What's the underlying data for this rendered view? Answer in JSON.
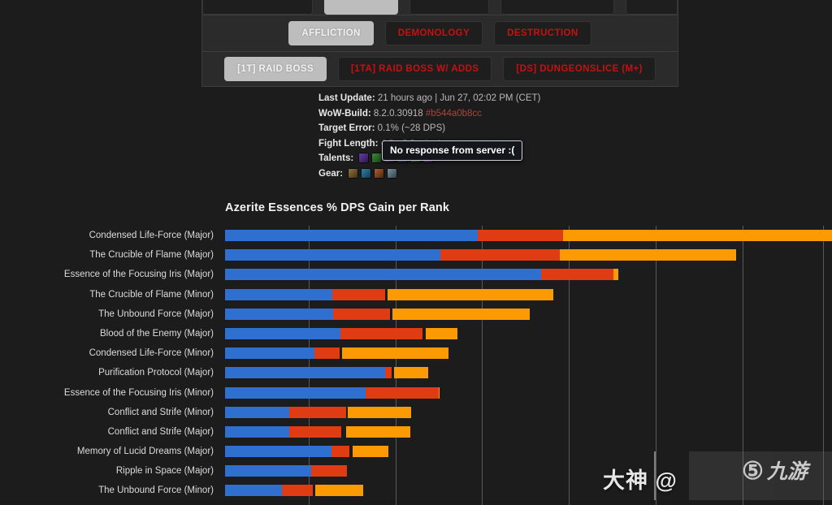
{
  "tabs": {
    "row_cut": [
      {
        "label": "",
        "active": false
      },
      {
        "label": "",
        "active": true
      },
      {
        "label": "",
        "active": false
      },
      {
        "label": "",
        "active": false
      },
      {
        "label": "",
        "active": false
      }
    ],
    "spec_row": [
      {
        "label": "AFFLICTION",
        "active": true
      },
      {
        "label": "DEMONOLOGY",
        "active": false
      },
      {
        "label": "DESTRUCTION",
        "active": false
      }
    ],
    "fight_row": [
      {
        "label": "[1T] RAID BOSS",
        "active": true
      },
      {
        "label": "[1TA] RAID BOSS W/ ADDS",
        "active": false
      },
      {
        "label": "[DS] DUNGEONSLICE (M+)",
        "active": false
      }
    ]
  },
  "meta": {
    "last_update_key": "Last Update:",
    "last_update_value": "21 hours ago | Jun 27, 02:02 PM (CET)",
    "wow_build_key": "WoW-Build:",
    "wow_build_value": "8.2.0.30918",
    "wow_build_hash": "#b544a0b8cc",
    "target_error_key": "Target Error:",
    "target_error_value": "0.1% (~28 DPS)",
    "fight_length_key": "Fight Length:",
    "fight_length_value": "4.0 - 6.0 minutes",
    "talents_key": "Talents:",
    "gear_key": "Gear:"
  },
  "tooltip": {
    "message": "No response from server :("
  },
  "watermark": {
    "text": "大神 @",
    "logo_mark": "⑤",
    "logo_cn": "九游"
  },
  "chart_data": {
    "type": "bar",
    "title": "Azerite Essences % DPS Gain per Rank",
    "xlabel": "",
    "ylabel": "",
    "orientation": "horizontal",
    "stacked": true,
    "grid": true,
    "legend": null,
    "xlim": [
      0,
      10.15
    ],
    "gridlines": [
      1.4,
      2.85,
      4.3,
      5.75,
      7.2,
      8.65,
      10.0
    ],
    "series": [
      {
        "name": "Rank 1",
        "color": "#2f6fd0"
      },
      {
        "name": "Rank 2",
        "color": "#e03c14"
      },
      {
        "name": "Rank 3",
        "color": "#fb9a02"
      }
    ],
    "categories": [
      "Condensed Life-Force (Major)",
      "The Crucible of Flame (Major)",
      "Essence of the Focusing Iris (Major)",
      "The Crucible of Flame (Minor)",
      "The Unbound Force (Major)",
      "Blood of the Enemy (Major)",
      "Condensed Life-Force (Minor)",
      "Purification Protocol (Major)",
      "Essence of the Focusing Iris (Minor)",
      "Conflict and Strife (Minor)",
      "Conflict and Strife (Major)",
      "Memory of Lucid Dreams (Major)",
      "Ripple in Space (Major)",
      "The Unbound Force (Minor)"
    ],
    "rows": [
      {
        "category": "Condensed Life-Force (Major)",
        "segments": [
          4.22,
          1.43,
          4.5
        ],
        "gaps": [
          0,
          0
        ],
        "total": 10.15
      },
      {
        "category": "The Crucible of Flame (Major)",
        "segments": [
          3.6,
          2.0,
          2.95
        ],
        "gaps": [
          0,
          0
        ],
        "total": 8.55
      },
      {
        "category": "Essence of the Focusing Iris (Major)",
        "segments": [
          5.28,
          1.21,
          0.09
        ],
        "gaps": [
          0,
          0
        ],
        "total": 6.58
      },
      {
        "category": "The Crucible of Flame (Minor)",
        "segments": [
          1.8,
          0.88,
          2.77
        ],
        "gaps": [
          0,
          0.04
        ],
        "total": 5.45
      },
      {
        "category": "The Unbound Force (Major)",
        "segments": [
          1.81,
          0.95,
          2.3
        ],
        "gaps": [
          0,
          0.04
        ],
        "total": 5.06
      },
      {
        "category": "Blood of the Enemy (Major)",
        "segments": [
          1.93,
          1.37,
          0.53
        ],
        "gaps": [
          0,
          0.05
        ],
        "total": 3.83
      },
      {
        "category": "Condensed Life-Force (Minor)",
        "segments": [
          1.5,
          0.42,
          1.78
        ],
        "gaps": [
          0,
          0.03
        ],
        "total": 3.7
      },
      {
        "category": "Purification Protocol (Major)",
        "segments": [
          2.68,
          0.1,
          0.58
        ],
        "gaps": [
          0,
          0.04
        ],
        "total": 3.36
      },
      {
        "category": "Essence of the Focusing Iris (Minor)",
        "segments": [
          2.35,
          1.22,
          0.02
        ],
        "gaps": [
          0,
          0
        ],
        "total": 3.59
      },
      {
        "category": "Conflict and Strife (Minor)",
        "segments": [
          1.08,
          0.94,
          1.06
        ],
        "gaps": [
          0,
          0.03
        ],
        "total": 3.08
      },
      {
        "category": "Conflict and Strife (Major)",
        "segments": [
          1.08,
          0.86,
          1.08
        ],
        "gaps": [
          0,
          0.08
        ],
        "total": 3.02
      },
      {
        "category": "Memory of Lucid Dreams (Major)",
        "segments": [
          1.78,
          0.3,
          0.6
        ],
        "gaps": [
          0,
          0.05
        ],
        "total": 2.68
      },
      {
        "category": "Ripple in Space (Major)",
        "segments": [
          1.44,
          0.6,
          0.0
        ],
        "gaps": [
          0,
          0
        ],
        "total": 2.04
      },
      {
        "category": "The Unbound Force (Minor)",
        "segments": [
          0.95,
          0.52,
          0.8
        ],
        "gaps": [
          0,
          0.04
        ],
        "total": 2.27
      }
    ]
  }
}
